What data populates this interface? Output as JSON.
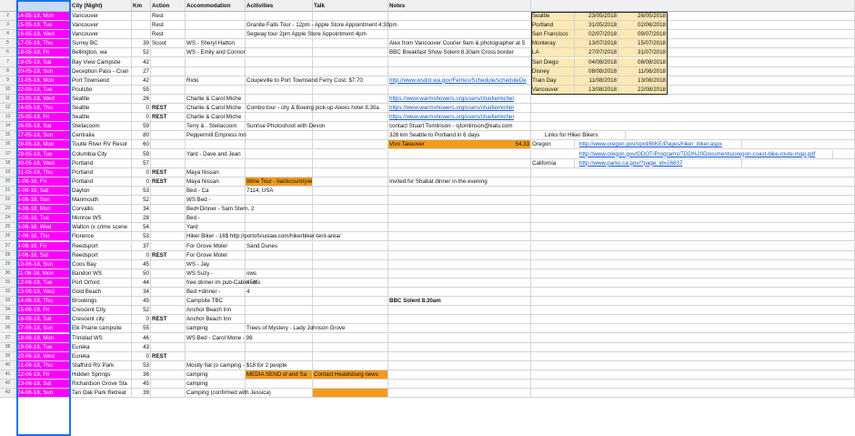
{
  "header": {
    "row_num": "",
    "col_a": "",
    "city": "City (Night)",
    "km": "Km",
    "action": "Action",
    "accommodation": "Accommodation",
    "activities": "Acitivities",
    "talk": "Talk",
    "notes": "Notes"
  },
  "rows": [
    {
      "n": "2",
      "date": "14-05-18, Mon",
      "city": "Vancouver",
      "km": "",
      "action": "Rest",
      "acc": "",
      "act": "",
      "talk": "",
      "notes": ""
    },
    {
      "n": "3",
      "date": "15-05-18, Tue",
      "city": "Vancouver",
      "km": "",
      "action": "Rest",
      "acc": "",
      "act": "Granite Falls Tour - 12pm - Apple Store Appointment 4:30pm",
      "talk": "",
      "notes": ""
    },
    {
      "n": "4",
      "date": "16-05-18, Wed",
      "city": "Vancouver",
      "km": "",
      "action": "Rest",
      "acc": "",
      "act": "Segway tour 2pm Apple Store Appointment 4pm",
      "talk": "",
      "notes": ""
    },
    {
      "n": "5",
      "date": "17-05-18, Thu",
      "city": "Surrey BC",
      "km": "39",
      "action": "Scoot",
      "acc": "WS - Sheryl Hatton",
      "act": "",
      "talk": "",
      "notes": "Alex from Vancouver Courier 9am & photographer at 5"
    },
    {
      "n": "6",
      "date": "18-05-18, Fri",
      "city": "Bellington, wa",
      "km": "52",
      "action": "",
      "acc": "WS - Emily and Connor",
      "act": "",
      "talk": "",
      "notes": "BBC Breakfast Show Solent 8.30am Cross border"
    },
    {
      "n": "7",
      "date": "19-05-18, Sat",
      "city": "Bay View Campsite",
      "km": "42",
      "action": "",
      "acc": "",
      "act": "",
      "talk": "",
      "notes": ""
    },
    {
      "n": "8",
      "date": "20-05-18, Sun",
      "city": "Deception Pass - Cran",
      "km": "27",
      "action": "",
      "acc": "",
      "act": "",
      "talk": "",
      "notes": ""
    },
    {
      "n": "9",
      "date": "21-05-18, Mon",
      "city": "Port Townsend",
      "km": "42",
      "action": "",
      "acc": "Ricki",
      "act": "Coupeville to Port Townsend Ferry Cost: $7.70",
      "talk": "",
      "notes": "http://www.wsdot.wa.gov/Ferries/Schedule/scheduleDe"
    },
    {
      "n": "10",
      "date": "22-05-18, Tue",
      "city": "Poulsbo",
      "km": "55",
      "action": "",
      "acc": "",
      "act": "",
      "talk": "",
      "notes": ""
    },
    {
      "n": "11",
      "date": "23-05-18, Wed",
      "city": "Seattle",
      "km": "26",
      "action": "",
      "acc": "Charlie & Carol Miche",
      "act": "",
      "talk": "",
      "notes": "https://www.warmshowers.org/users/charliemichel"
    },
    {
      "n": "12",
      "date": "24-05-18, Thu",
      "city": "Seattle",
      "km": "0",
      "action": "REST",
      "acc": "Charlie & Carol Miche",
      "act": "Combo tour - city & Boeing pick-up Alexis hotel 8.30a",
      "talk": "",
      "notes": "https://www.warmshowers.org/users/charliemichel"
    },
    {
      "n": "13",
      "date": "25-05-18, Fri",
      "city": "Seattle",
      "km": "0",
      "action": "REST",
      "acc": "Charlie & Carol Miche",
      "act": "",
      "talk": "",
      "notes": "https://www.warmshowers.org/users/charliemichel"
    },
    {
      "n": "14",
      "date": "26-05-18, Sat",
      "city": "Steilacoom",
      "km": "59",
      "action": "",
      "acc": "Terry & . Steilacoom",
      "act": "Sunrise Photoshoot with Devon",
      "talk": "",
      "notes": "contact Stuart Tomlinson - sjtomlinson@katu.com"
    },
    {
      "n": "15",
      "date": "27-05-18, Sun",
      "city": "Centralia",
      "km": "80",
      "action": "",
      "acc": "Peppermill Empress Inn",
      "act": "",
      "talk": "",
      "notes": "326 km Seattle to Portland in 6 days"
    },
    {
      "n": "16",
      "date": "28-05-18, Mon",
      "city": "Toutle River RV Resor",
      "km": "60",
      "action": "",
      "acc": "",
      "act": "",
      "talk": "",
      "notes": "Vivo Takeover"
    },
    {
      "n": "17",
      "date": "29-05-18, Tue",
      "city": "Columbia City",
      "km": "59",
      "action": "",
      "acc": "Yard - Dave and Jean",
      "act": "",
      "talk": "",
      "notes": ""
    },
    {
      "n": "18",
      "date": "30-05-18, Wed",
      "city": "Portland",
      "km": "57",
      "action": "",
      "acc": "",
      "act": "",
      "talk": "",
      "notes": ""
    },
    {
      "n": "19",
      "date": "31-05-18, Thu",
      "city": "Portland",
      "km": "0",
      "action": "REST",
      "acc": "Maya Nissan",
      "act": "",
      "talk": "",
      "notes": ""
    },
    {
      "n": "20",
      "date": "1-06-18, Fri",
      "city": "Portland",
      "km": "0",
      "action": "REST",
      "acc": "Maya Nissan",
      "act": "Wine Tour - backcountrywine@gmail.com",
      "talk": "",
      "notes": "Invited for Shabat dinner in the evening"
    },
    {
      "n": "21",
      "date": "2-06-18, Sat",
      "city": "Dayton",
      "km": "53",
      "action": "",
      "acc": "Bed - Ca",
      "act": "7114, USA",
      "talk": "",
      "notes": ""
    },
    {
      "n": "22",
      "date": "3-06-18, Sun",
      "city": "Manmouth",
      "km": "52",
      "action": "",
      "acc": "WS Bed -",
      "act": "",
      "talk": "",
      "notes": ""
    },
    {
      "n": "23",
      "date": "4-06-18, Mon",
      "city": "Corvallis",
      "km": "34",
      "action": "",
      "acc": "Bed+Dinner - Sam Stern, 2",
      "act": "",
      "talk": "",
      "notes": ""
    },
    {
      "n": "24",
      "date": "5-06-18, Tue",
      "city": "Monroe WS",
      "km": "28",
      "action": "",
      "acc": "Bed -",
      "act": "",
      "talk": "",
      "notes": ""
    },
    {
      "n": "25",
      "date": "6-06-18, Wed",
      "city": "Walton (x crime scene",
      "km": "54",
      "action": "",
      "acc": "Yard",
      "act": "",
      "talk": "",
      "notes": ""
    },
    {
      "n": "26",
      "date": "7-06-18, Thu",
      "city": "Florence",
      "km": "53",
      "action": "",
      "acc": "Hiker Biker - 16$ http://portofsiuslaw.com/hikerbiker-tent-area/",
      "act": "",
      "talk": "",
      "notes": ""
    },
    {
      "n": "27",
      "date": "8-06-18, Fri",
      "city": "Reedsport",
      "km": "37",
      "action": "",
      "acc": "For Grove Motel",
      "act": "Sand Dunes",
      "talk": "",
      "notes": ""
    },
    {
      "n": "28",
      "date": "9-06-18, Sat",
      "city": "Reedsport",
      "km": "0",
      "action": "REST",
      "acc": "For Grove Motel",
      "act": "",
      "talk": "",
      "notes": ""
    },
    {
      "n": "29",
      "date": "10-06-18, Sun",
      "city": "Coos Bay",
      "km": "45",
      "action": "",
      "acc": "WS - Jay",
      "act": "",
      "talk": "",
      "notes": ""
    },
    {
      "n": "30",
      "date": "11-06-18, Mon",
      "city": "Bandon WS",
      "km": "50",
      "action": "",
      "acc": "WS Suzy -",
      "act": "ows",
      "talk": "",
      "notes": ""
    },
    {
      "n": "31",
      "date": "12-06-18, Tue",
      "city": "Port Orford",
      "km": "44",
      "action": "",
      "acc": "free dinner im pub-Cabin - It's",
      "act": "45m",
      "talk": "",
      "notes": ""
    },
    {
      "n": "32",
      "date": "13-06-18, Wed",
      "city": "Gold Beach",
      "km": "34",
      "action": "",
      "acc": "Bed +dinner -",
      "act": "4",
      "talk": "",
      "notes": ""
    },
    {
      "n": "33",
      "date": "14-06-18, Thu",
      "city": "Brookings",
      "km": "45",
      "action": "",
      "acc": "Campsite TBC",
      "act": "",
      "talk": "",
      "notes": "BBC Solent 8.30am"
    },
    {
      "n": "34",
      "date": "15-06-18, Fri",
      "city": "Crescent City",
      "km": "52",
      "action": "",
      "acc": "Anchor Beach Inn",
      "act": "",
      "talk": "",
      "notes": ""
    },
    {
      "n": "35",
      "date": "16-06-18, Sat",
      "city": "Crescent city",
      "km": "0",
      "action": "REST",
      "acc": "Anchor Beach Inn",
      "act": "",
      "talk": "",
      "notes": ""
    },
    {
      "n": "36",
      "date": "17-06-18, Sun",
      "city": "Elk Prairie campsite",
      "km": "55",
      "action": "",
      "acc": "camping",
      "act": "Trees of Mystery - Lady Johnson Grove",
      "talk": "",
      "notes": ""
    },
    {
      "n": "37",
      "date": "18-06-18, Mon",
      "city": "Trinidad WS",
      "km": "46",
      "action": "",
      "acc": "WS Bed - Carol Mone - 99",
      "act": "",
      "talk": "",
      "notes": ""
    },
    {
      "n": "38",
      "date": "19-06-18, Tue",
      "city": "Eureka",
      "km": "43",
      "action": "",
      "acc": "",
      "act": "",
      "talk": "",
      "notes": ""
    },
    {
      "n": "39",
      "date": "20-06-18, Wed",
      "city": "Eureka",
      "km": "0",
      "action": "REST",
      "acc": "",
      "act": "",
      "talk": "",
      "notes": ""
    },
    {
      "n": "40",
      "date": "21-06-18, Thu",
      "city": "Stafford RV Park",
      "km": "53",
      "action": "",
      "acc": "Mostly flat (o camping - $18 for 2 people",
      "act": "",
      "talk": "",
      "notes": ""
    },
    {
      "n": "41",
      "date": "22-06-18, Fri",
      "city": "Hidden Springs",
      "km": "36",
      "action": "",
      "acc": "camping",
      "act": "MEDIA SEND sf and Sa",
      "talk": "Contact Healdsburg news",
      "notes": ""
    },
    {
      "n": "42",
      "date": "23-06-18, Sat",
      "city": "Richardson Grove Sta",
      "km": "45",
      "action": "",
      "acc": "camping",
      "act": "",
      "talk": "",
      "notes": ""
    },
    {
      "n": "43",
      "date": "24-06-18, Sun",
      "city": "Tan Oak Park Retreat",
      "km": "39",
      "action": "",
      "acc": "Camping (confirmed with Jessica)",
      "act": "",
      "talk": "",
      "notes": ""
    }
  ],
  "side_table": [
    {
      "name": "Seattle",
      "start": "23/05/2018",
      "end": "26/05/2018"
    },
    {
      "name": "Portland",
      "start": "31/05/2018",
      "end": "02/06/2018"
    },
    {
      "name": "San Francisco",
      "start": "02/07/2018",
      "end": "09/07/2018"
    },
    {
      "name": "Monteray",
      "start": "13/07/2018",
      "end": "15/07/2018"
    },
    {
      "name": "LA",
      "start": "27/07/2018",
      "end": "31/07/2018"
    },
    {
      "name": "San Diego",
      "start": "04/08/2018",
      "end": "08/08/2018"
    },
    {
      "name": "Disney",
      "start": "08/08/2018",
      "end": "11/08/2018"
    },
    {
      "name": "Train Day",
      "start": "11/08/2018",
      "end": "13/08/2018"
    },
    {
      "name": "Vancouver",
      "start": "13/08/2018",
      "end": "22/08/2018"
    }
  ],
  "extras": {
    "n1543": "54.33",
    "oregon": "Oregon",
    "california": "California",
    "links_header": "Links for Hiker Bikers",
    "link1": "http://www.oregon.gov/oprd/BIKE/Pages/hiker_biker.aspx",
    "link2": "http://www.oregon.gov/ODOT/Programs/TDD%20Documents/oregon-coast-bike-route-map.pdf",
    "link3": "http://www.parks.ca.gov/?page_id=26837"
  }
}
